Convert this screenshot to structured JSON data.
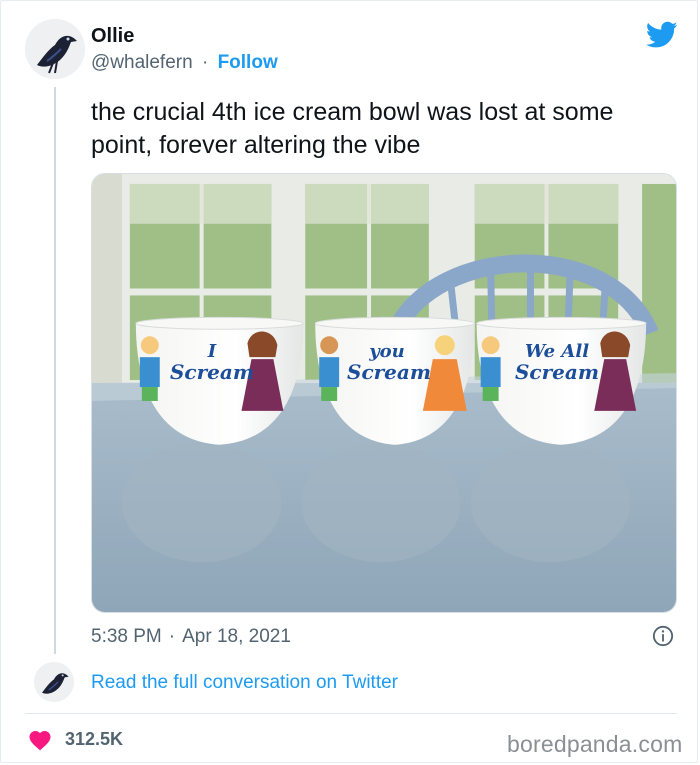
{
  "author": {
    "name": "Ollie",
    "handle": "@whalefern",
    "separator": "·",
    "follow_label": "Follow"
  },
  "tweet": {
    "text": "the crucial 4th ice cream bowl was lost at some point, forever altering the vibe",
    "time": "5:38 PM",
    "separator": "·",
    "date": "Apr 18, 2021"
  },
  "photo": {
    "bowls": [
      {
        "text_line1": "I",
        "text_line2": "Scream"
      },
      {
        "text_line1": "you",
        "text_line2": "Scream"
      },
      {
        "text_line1": "We All",
        "text_line2": "Scream"
      }
    ]
  },
  "conversation": {
    "link_label": "Read the full conversation on Twitter"
  },
  "stats": {
    "likes": "312.5K"
  },
  "watermark": "boredpanda.com",
  "colors": {
    "twitter_blue": "#1d9bf0",
    "heart_red": "#f91880",
    "muted_text": "#536471"
  },
  "icons": [
    "crow-avatar",
    "twitter-bird-icon",
    "info-icon",
    "heart-icon"
  ]
}
